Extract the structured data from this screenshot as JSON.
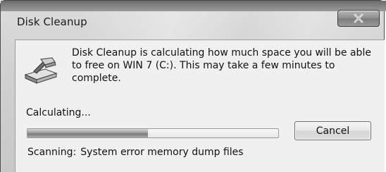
{
  "window": {
    "title": "Disk Cleanup",
    "close_icon": "close-icon"
  },
  "dialog": {
    "app_icon": "disk-cleanup-icon",
    "message": "Disk Cleanup is calculating how much space you will be able to free on WIN 7 (C:). This may take a few minutes to complete.",
    "status_label": "Calculating...",
    "progress": {
      "percent": 48
    },
    "cancel_label": "Cancel",
    "scan_prefix": "Scanning:",
    "scan_item": "System error memory dump files"
  }
}
